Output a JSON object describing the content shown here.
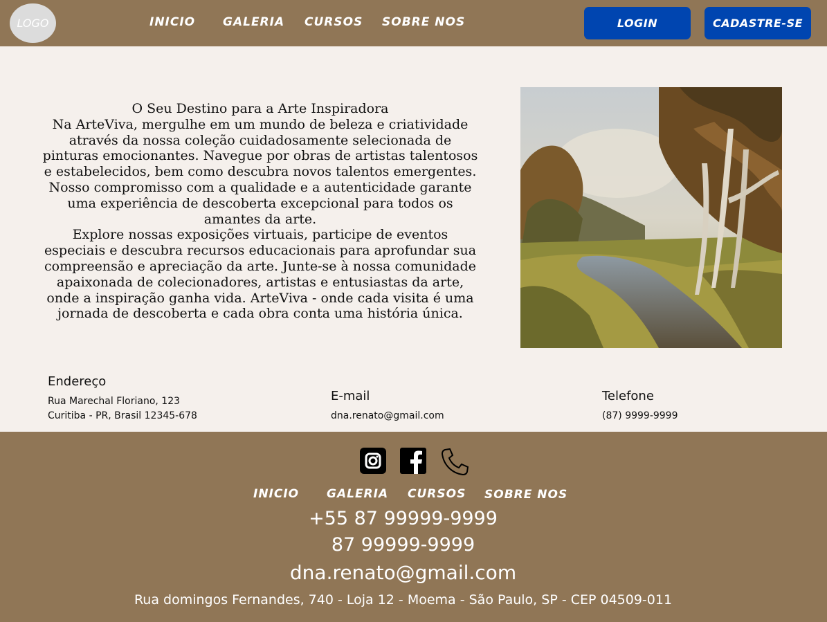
{
  "header": {
    "logo": "LOGO",
    "nav": [
      "INICIO",
      "GALERIA",
      "CURSOS",
      "SOBRE NOS"
    ],
    "login": "LOGIN",
    "signup": "CADASTRE-SE"
  },
  "hero": {
    "title": "O Seu Destino para a Arte Inspiradora",
    "paragraph1": "Na ArteViva, mergulhe em um mundo de beleza e criatividade através da nossa coleção cuidadosamente selecionada de pinturas emocionantes. Navegue por obras de artistas talentosos e estabelecidos, bem como descubra novos talentos emergentes. Nosso compromisso com a qualidade e a autenticidade garante uma experiência de descoberta excepcional para todos os amantes da arte.",
    "paragraph2": "Explore nossas exposições virtuais, participe de eventos especiais e descubra recursos educacionais para aprofundar sua compreensão e apreciação da arte. Junte-se à nossa comunidade apaixonada de colecionadores, artistas e entusiastas da arte, onde a inspiração ganha vida. ArteViva - onde cada visita é uma jornada de descoberta e cada obra conta uma história única."
  },
  "contact": {
    "address_title": "Endereço",
    "address_line1": "Rua Marechal Floriano, 123",
    "address_line2": "Curitiba - PR, Brasil 12345-678",
    "email_title": "E-mail",
    "email": "dna.renato@gmail.com",
    "phone_title": "Telefone",
    "phone": "(87) 9999-9999"
  },
  "footer": {
    "nav": [
      "INICIO",
      "GALERIA",
      "CURSOS",
      "SOBRE NOS"
    ],
    "phone1": "+55 87 99999-9999",
    "phone2": "87 99999-9999",
    "email": "dna.renato@gmail.com",
    "address": "Rua domingos Fernandes, 740 - Loja 12 - Moema - São Paulo, SP - CEP 04509-011",
    "icons": [
      "instagram-icon",
      "facebook-icon",
      "phone-icon"
    ]
  },
  "colors": {
    "brand_brown": "#907656",
    "button_blue": "#0045b0",
    "background": "#f5f0ec"
  }
}
